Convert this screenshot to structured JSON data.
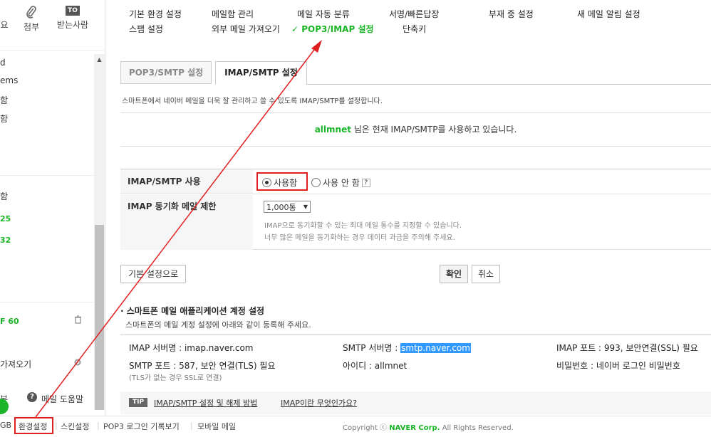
{
  "sidebar": {
    "tools": [
      {
        "label": "요",
        "icon": "sort-icon"
      },
      {
        "label": "첨부",
        "icon": "paperclip-icon"
      },
      {
        "label": "받는사람",
        "icon": "to-icon",
        "badge": "TO"
      }
    ],
    "items_upper": [
      "d",
      "ems",
      "함",
      "함"
    ],
    "items_lower": [
      {
        "label": "함"
      },
      {
        "label": "25"
      },
      {
        "label": "32"
      }
    ],
    "count_item": "F 60",
    "import_item": "가져오기",
    "help_left": "본",
    "help_label": "메일 도움말"
  },
  "top_menu": {
    "row1": [
      "기본 환경 설정",
      "메일함 관리",
      "메일 자동 분류",
      "서명/빠른답장",
      "부재 중 설정",
      "새 메일 알림 설정"
    ],
    "row2": [
      "스팸 설정",
      "외부 메일 가져오기",
      "POP3/IMAP 설정",
      "단축키"
    ],
    "active_check": "✓"
  },
  "tabs": {
    "pop3": "POP3/SMTP 설정",
    "imap": "IMAP/SMTP 설정"
  },
  "description": "스마트폰에서 네이버 메일을 더욱 잘 관리하고 쓸 수 있도록 IMAP/SMTP를 설정합니다.",
  "notice": {
    "user": "allmnet",
    "text": " 님은 현재 IMAP/SMTP를 사용하고 있습니다."
  },
  "settings": {
    "use_label": "IMAP/SMTP 사용",
    "use_option": "사용함",
    "nouse_option": "사용 안 함",
    "help_q": "?",
    "limit_label": "IMAP 동기화 메일 제한",
    "limit_value": "1,000통",
    "limit_desc1": "IMAP으로 동기화할 수 있는 최대 메일 통수를 지정할 수 있습니다.",
    "limit_desc2": "너무 많은 메일을 동기화하는 경우 데이터 과금을 주의해 주세요."
  },
  "buttons": {
    "reset": "기본 설정으로",
    "confirm": "확인",
    "cancel": "취소"
  },
  "app_settings": {
    "title": "스마트폰 메일 애플리케이션 계정 설정",
    "subtitle": "스마트폰의 메일 계정 설정에 아래와 같이 등록해 주세요.",
    "imap_server": "IMAP 서버명 : imap.naver.com",
    "smtp_server_label": "SMTP 서버명 : ",
    "smtp_server_value": "smtp.naver.com",
    "imap_port": "IMAP 포트 : 993, 보안연결(SSL) 필요",
    "smtp_port": "SMTP 포트 : 587, 보안 연결(TLS) 필요",
    "smtp_port_note": "(TLS가 없는 경우 SSL로 연결)",
    "id": "아이디 : allmnet",
    "password": "비밀번호 : 네이버 로그인 비밀번호"
  },
  "tip": {
    "badge": "TIP",
    "link1": "IMAP/SMTP 설정 및 해제 방법",
    "link2": "IMAP이란 무엇인가요?"
  },
  "footer": {
    "storage": "GB",
    "links": [
      "환경설정",
      "스킨설정",
      "POP3 로그인 기록보기",
      "모바일 메일"
    ],
    "copyright_pre": "Copyright ⓒ ",
    "copyright_brand": "NAVER Corp.",
    "copyright_post": " All Rights Reserved."
  },
  "colors": {
    "accent_green": "#1cb529",
    "annotation_red": "#e02020"
  }
}
